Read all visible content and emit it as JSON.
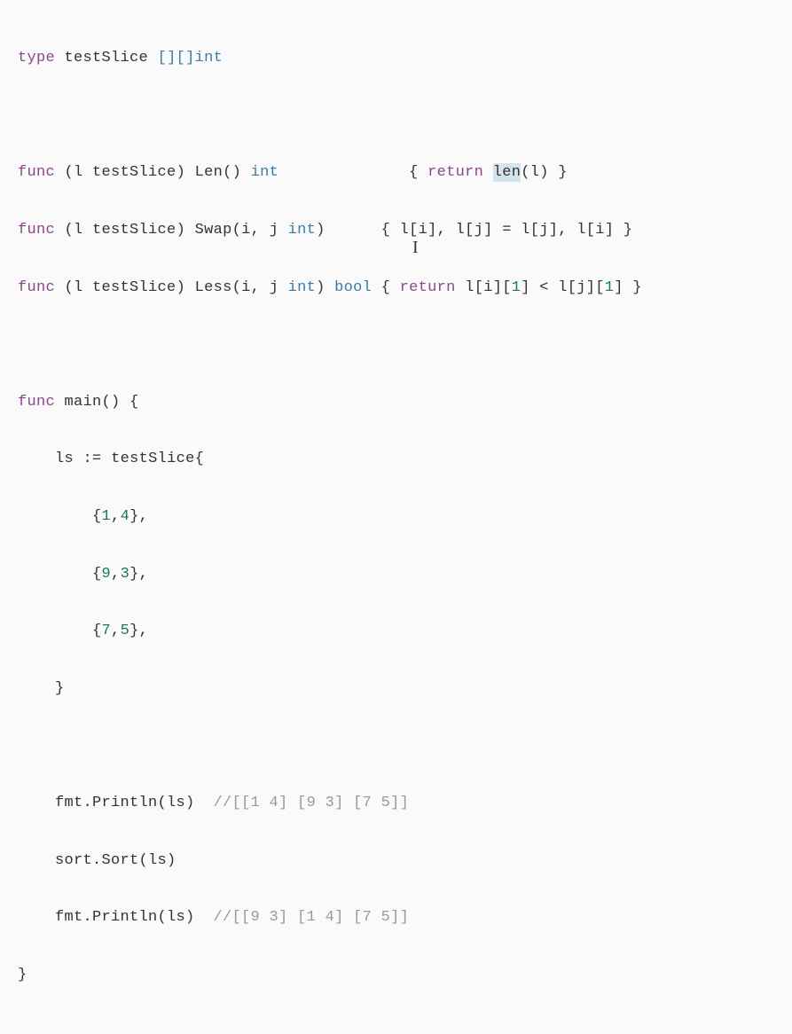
{
  "code": {
    "l1": {
      "kw_type": "type",
      "name": "testSlice",
      "typ": "[][]int"
    },
    "l3": {
      "kw_func": "func",
      "recv_open": "(l ",
      "recv_type": "testSlice",
      "recv_close": ") ",
      "fn": "Len",
      "params": "()",
      "ret": " int",
      "body_open": "{ ",
      "kw_return": "return",
      "sp": " ",
      "builtin": "len",
      "args": "(l) ",
      "body_close": "}"
    },
    "l4": {
      "kw_func": "func",
      "recv_open": "(l ",
      "recv_type": "testSlice",
      "recv_close": ") ",
      "fn": "Swap",
      "params_open": "(i, j ",
      "params_type": "int",
      "params_close": ")",
      "body_open": "{ ",
      "stmt": "l[i], l[j] = l[j], l[i] ",
      "body_close": "}"
    },
    "l5": {
      "kw_func": "func",
      "recv_open": "(l ",
      "recv_type": "testSlice",
      "recv_close": ") ",
      "fn": "Less",
      "params_open": "(i, j ",
      "params_type": "int",
      "params_close": ") ",
      "ret": "bool",
      "body_open": " { ",
      "kw_return": "return",
      "stmt": " l[i][",
      "n1": "1",
      "mid": "] < l[j][",
      "n2": "1",
      "end": "] ",
      "body_close": "}"
    },
    "l7": {
      "kw_func": "func",
      "fn": "main",
      "params": "()",
      "brace": " {"
    },
    "l8": {
      "indent": "    ",
      "var": "ls ",
      "op": ":=",
      "sp": " ",
      "type": "testSlice",
      "brace": "{"
    },
    "l9": {
      "indent": "        ",
      "open": "{",
      "n1": "1",
      "comma": ",",
      "n2": "4",
      "close": "},"
    },
    "l10": {
      "indent": "        ",
      "open": "{",
      "n1": "9",
      "comma": ",",
      "n2": "3",
      "close": "},"
    },
    "l11": {
      "indent": "        ",
      "open": "{",
      "n1": "7",
      "comma": ",",
      "n2": "5",
      "close": "},"
    },
    "l12": {
      "indent": "    ",
      "brace": "}"
    },
    "l14": {
      "indent": "    ",
      "call": "fmt.Println(ls)  ",
      "comment": "//[[1 4] [9 3] [7 5]]"
    },
    "l15": {
      "indent": "    ",
      "call": "sort.Sort(ls)"
    },
    "l16": {
      "indent": "    ",
      "call": "fmt.Println(ls)  ",
      "comment": "//[[9 3] [1 4] [7 5]]"
    },
    "l17": {
      "brace": "}"
    }
  },
  "cursor_glyph": "I"
}
